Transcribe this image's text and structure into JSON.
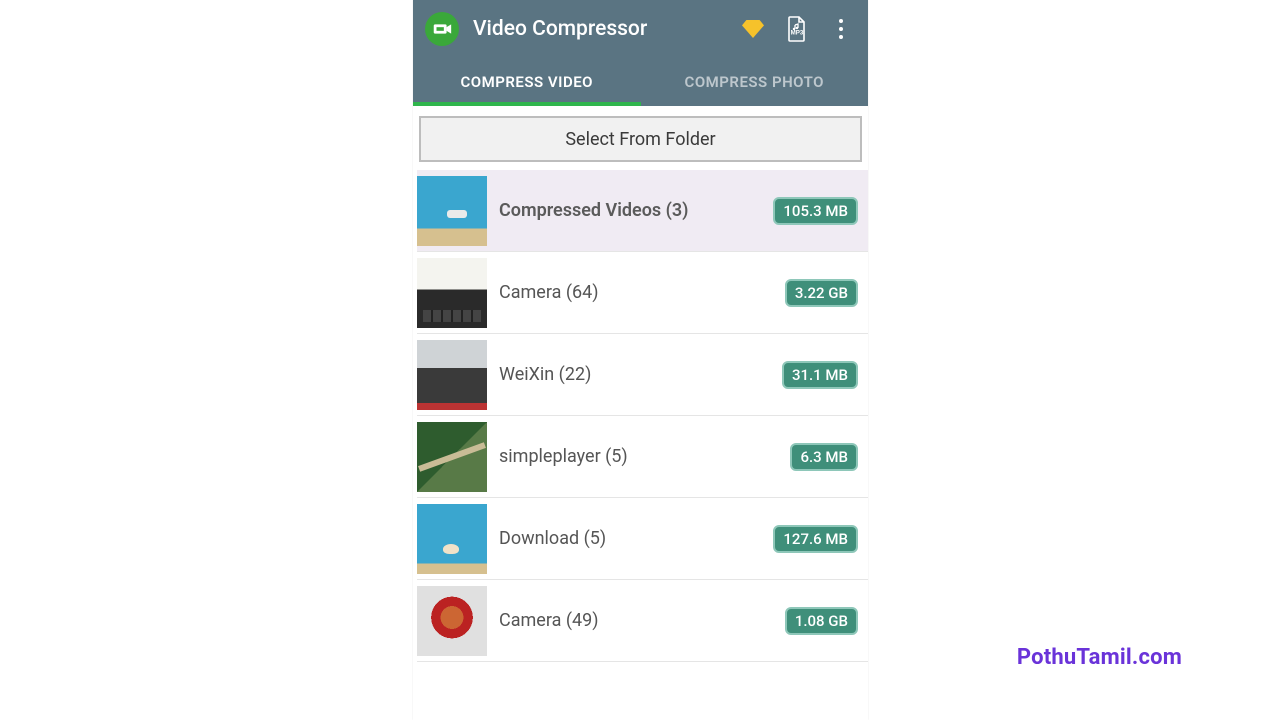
{
  "appbar": {
    "title": "Video Compressor",
    "icons": {
      "app": "compressor-badge-icon",
      "premium": "diamond-icon",
      "convert": "file-mp3-icon",
      "overflow": "overflow-menu-icon"
    }
  },
  "tabs": {
    "compress_video": "COMPRESS VIDEO",
    "compress_photo": "COMPRESS PHOTO",
    "active": "compress_video"
  },
  "select_folder_label": "Select From Folder",
  "folders": [
    {
      "label": "Compressed Videos (3)",
      "size": "105.3 MB",
      "selected": true,
      "thumb": "pool"
    },
    {
      "label": "Camera (64)",
      "size": "3.22 GB",
      "selected": false,
      "thumb": "keyboard"
    },
    {
      "label": "WeiXin (22)",
      "size": "31.1 MB",
      "selected": false,
      "thumb": "car"
    },
    {
      "label": "simpleplayer (5)",
      "size": "6.3 MB",
      "selected": false,
      "thumb": "forest"
    },
    {
      "label": "Download (5)",
      "size": "127.6 MB",
      "selected": false,
      "thumb": "pool2"
    },
    {
      "label": "Camera (49)",
      "size": "1.08 GB",
      "selected": false,
      "thumb": "ride"
    }
  ],
  "watermark": "PothuTamil.com",
  "colors": {
    "appbar_bg": "#5a7482",
    "accent": "#2fb54c",
    "chip_bg": "#3f8f7a",
    "chip_border": "#8ec7b9",
    "watermark": "#6a33d9"
  }
}
